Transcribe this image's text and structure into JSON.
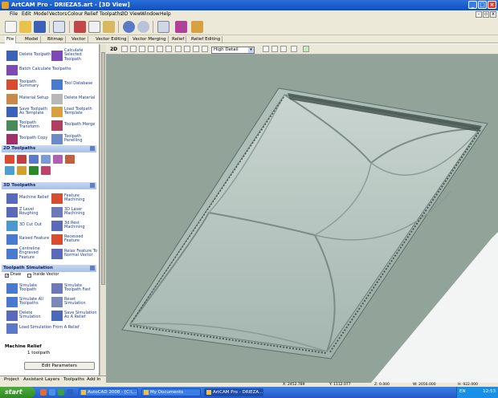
{
  "window": {
    "title": "ArtCAM Pro - DRIEZA5.art - [3D View]",
    "min": "_",
    "max": "□",
    "close": "×"
  },
  "menu": [
    "File",
    "Edit",
    "Model",
    "Vectors",
    "Colour",
    "Relief",
    "Toolpaths",
    "3D View",
    "Window",
    "Help"
  ],
  "ribbon_tabs": [
    "File",
    "Model",
    "Bitmap",
    "Vector",
    "Vector Editing",
    "Vector Merging",
    "Relief",
    "Relief Editing"
  ],
  "toolpath_ops": [
    [
      "Delete Toolpath",
      "Calculate Selected Toolpath"
    ],
    [
      "Batch Calculate Toolpaths",
      ""
    ],
    [
      "Toolpath Summary",
      "Tool Database"
    ],
    [
      "Material Setup",
      "Delete Material"
    ],
    [
      "Save Toolpath As Template",
      "Load Toolpath Template"
    ],
    [
      "Toolpath Transform",
      "Toolpath Merge"
    ],
    [
      "Toolpath Copy",
      "Toolpath Panelling"
    ]
  ],
  "sections": {
    "t2d": "2D Toolpaths",
    "t3d": "3D Toolpaths",
    "sim": "Toolpath Simulation"
  },
  "toolpaths_3d": [
    [
      "Machine Relief",
      "Feature Machining"
    ],
    [
      "Z Level Roughing",
      "3D Laser Machining"
    ],
    [
      "3D Cut Out",
      "3d Rest Machining"
    ],
    [
      "Raised Feature",
      "Recessed Feature"
    ],
    [
      "Centreline Engraved Feature",
      "Relax Feature To Normal Vector"
    ]
  ],
  "sim_options": {
    "draw": "Draw",
    "inside": "Inside Vector"
  },
  "simulation": [
    [
      "Simulate Toolpath",
      "Simulate Toolpath Fast"
    ],
    [
      "Simulate All Toolpaths",
      "Reset Simulation"
    ],
    [
      "Delete Simulation",
      "Save Simulation As A Relief"
    ],
    [
      "Load Simulation From A Relief",
      ""
    ]
  ],
  "machine_relief": {
    "title": "Machine Relief",
    "count": "1 toolpath",
    "edit": "Edit Parameters"
  },
  "bottom_tabs": [
    "Project",
    "Assistant",
    "Layers",
    "Toolpaths",
    "Add In"
  ],
  "view_toolbar": {
    "mode": "2D",
    "detail": "High Detail"
  },
  "status": {
    "x": "X: 2452.789",
    "y": "Y: 1112.077",
    "z": "Z: 0.000",
    "w": "W: 2056.000",
    "h": "H: 922.000"
  },
  "taskbar": {
    "start": "start",
    "tasks": [
      "AutoCAD 2008 - [C:\\...",
      "My Documents",
      "ArtCAM Pro - DRIEZA..."
    ],
    "lang": "EN",
    "clock": "12:53"
  },
  "colors": {
    "viewport_bg": "#92a39a",
    "model_face": "#a9bab4",
    "title_blue": "#1a5fd0",
    "panel_header": "#b8cceb"
  }
}
